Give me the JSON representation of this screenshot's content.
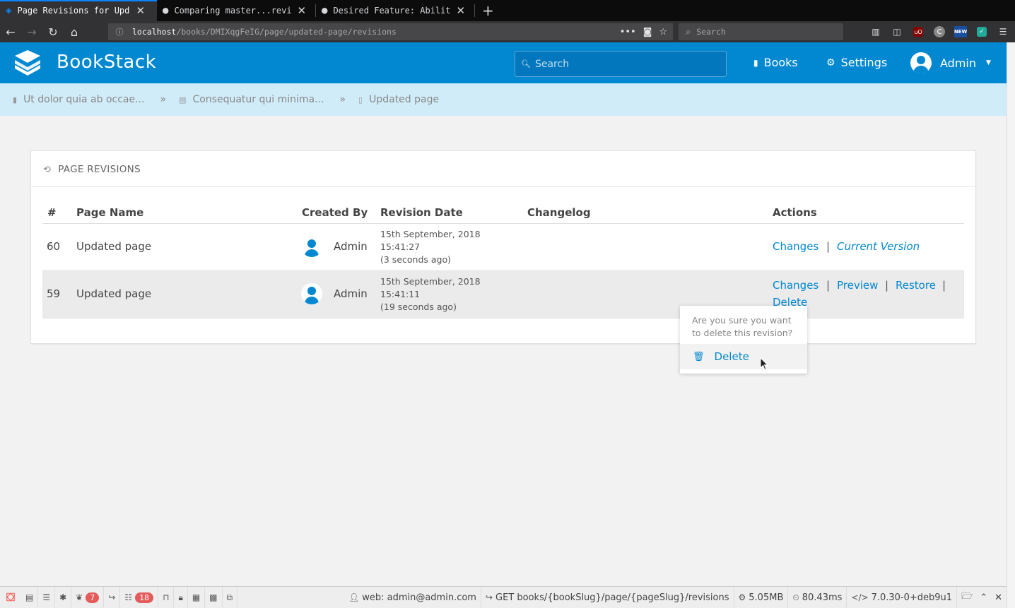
{
  "browser": {
    "tabs": [
      {
        "title": "Page Revisions for Upda",
        "active": true
      },
      {
        "title": "Comparing master...revi",
        "active": false
      },
      {
        "title": "Desired Feature: Abilit",
        "active": false
      }
    ],
    "url_host": "localhost",
    "url_path": "/books/DMIXqgFeIG/page/updated-page/revisions",
    "search_placeholder": "Search",
    "page_actions": "•••",
    "ext_new_label": "NEW",
    "ext_ub_label": "uO",
    "ext_c_label": "C"
  },
  "header": {
    "brand": "BookStack",
    "search_placeholder": "Search",
    "books_label": "Books",
    "settings_label": "Settings",
    "user_label": "Admin"
  },
  "breadcrumbs": [
    {
      "label": "Ut dolor quia ab occae...",
      "icon": "book-icon"
    },
    {
      "label": "Consequatur qui minima...",
      "icon": "chapter-icon"
    },
    {
      "label": "Updated page",
      "icon": "page-icon"
    }
  ],
  "breadcrumb_separator": "»",
  "revisions": {
    "title": "PAGE REVISIONS",
    "columns": [
      "#",
      "Page Name",
      "Created By",
      "Revision Date",
      "Changelog",
      "Actions"
    ],
    "rows": [
      {
        "id": "60",
        "page_name": "Updated page",
        "created_by": "Admin",
        "date": "15th September, 2018",
        "time": "15:41:27",
        "ago": "(3 seconds ago)",
        "changelog": "",
        "actions": {
          "changes": "Changes",
          "current": "Current Version"
        }
      },
      {
        "id": "59",
        "page_name": "Updated page",
        "created_by": "Admin",
        "date": "15th September, 2018",
        "time": "15:41:11",
        "ago": "(19 seconds ago)",
        "changelog": "",
        "actions": {
          "changes": "Changes",
          "preview": "Preview",
          "restore": "Restore",
          "delete": "Delete"
        }
      }
    ],
    "action_separator": "|"
  },
  "delete_popover": {
    "question": "Are you sure you want to delete this revision?",
    "confirm_label": "Delete"
  },
  "debugbar": {
    "badge_count_1": "7",
    "badge_count_2": "18",
    "user": "web: admin@admin.com",
    "route": "GET books/{bookSlug}/page/{pageSlug}/revisions",
    "memory": "5.05MB",
    "time": "80.43ms",
    "php_version": "7.0.30-0+deb9u1"
  },
  "colors": {
    "primary": "#0288d1",
    "breadcrumb_bg": "#d1ecf9",
    "badge": "#e35b5b"
  }
}
